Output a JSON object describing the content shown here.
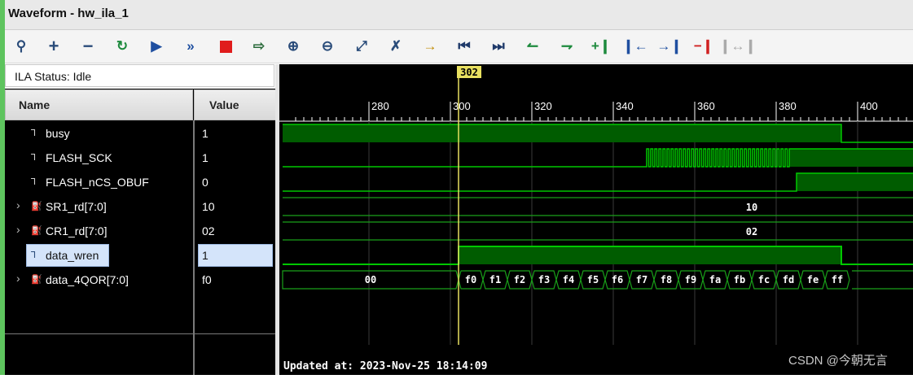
{
  "window": {
    "title": "Waveform - hw_ila_1"
  },
  "toolbar": {
    "icons": [
      "search-icon",
      "zoom-plus-icon",
      "zoom-minus-icon",
      "refresh-icon",
      "run-trigger-icon",
      "run-immediate-icon",
      "stop-icon",
      "export-icon",
      "zoom-in-icon",
      "zoom-out-icon",
      "zoom-fit-icon",
      "cursor-icon",
      "go-to-cursor-icon",
      "go-to-start-icon",
      "go-to-end-icon",
      "prev-transition-icon",
      "next-transition-icon",
      "add-marker-icon",
      "prev-marker-icon",
      "next-marker-icon",
      "swap-cursors-icon",
      "disabled-marker-icon"
    ]
  },
  "status": {
    "text": "ILA Status: Idle"
  },
  "columns": {
    "name": "Name",
    "value": "Value"
  },
  "signals": [
    {
      "name": "busy",
      "value": "1",
      "bus": false
    },
    {
      "name": "FLASH_SCK",
      "value": "1",
      "bus": false
    },
    {
      "name": "FLASH_nCS_OBUF",
      "value": "0",
      "bus": false
    },
    {
      "name": "SR1_rd[7:0]",
      "value": "10",
      "bus": true
    },
    {
      "name": "CR1_rd[7:0]",
      "value": "02",
      "bus": true
    },
    {
      "name": "data_wren",
      "value": "1",
      "bus": false,
      "selected": true
    },
    {
      "name": "data_4QOR[7:0]",
      "value": "f0",
      "bus": true
    }
  ],
  "timeline": {
    "ticks": [
      280,
      300,
      320,
      340,
      360,
      380,
      400
    ],
    "cursor": "302",
    "cursor_sample": 302
  },
  "waves": {
    "busy_fall": 396,
    "sck_start": 348,
    "sck_end": 383,
    "ncs_rise": 385,
    "wren_rise": 302,
    "wren_fall": 396,
    "sr1_value": "10",
    "cr1_value": "02",
    "q_initial": "00",
    "q_start": 302,
    "q_step": 6,
    "q_values": [
      "f0",
      "f1",
      "f2",
      "f3",
      "f4",
      "f5",
      "f6",
      "f7",
      "f8",
      "f9",
      "fa",
      "fb",
      "fc",
      "fd",
      "fe",
      "ff"
    ]
  },
  "footer": {
    "updated": "Updated at: 2023-Nov-25 18:14:09"
  },
  "watermark": "CSDN @今朝无言",
  "colors": {
    "wave": "#00c800",
    "fill": "#005c00",
    "cursor": "#e8e060",
    "bus_line": "#19a019"
  }
}
